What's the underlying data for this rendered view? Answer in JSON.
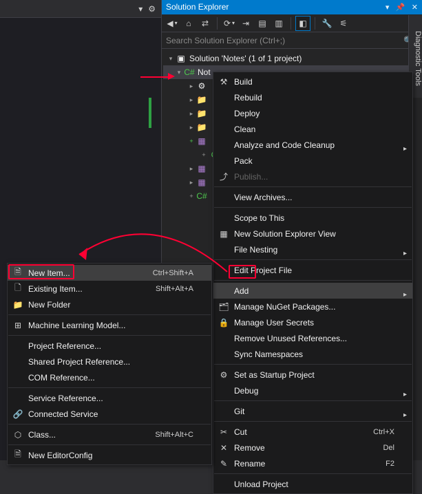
{
  "solution_explorer": {
    "title": "Solution Explorer",
    "search_placeholder": "Search Solution Explorer (Ctrl+;)",
    "solution_label": "Solution 'Notes' (1 of 1 project)",
    "project_label": "Not",
    "diagnostic_tab": "Diagnostic Tools"
  },
  "ctx_main": {
    "build": "Build",
    "rebuild": "Rebuild",
    "deploy": "Deploy",
    "clean": "Clean",
    "analyze": "Analyze and Code Cleanup",
    "pack": "Pack",
    "publish": "Publish...",
    "view_archives": "View Archives...",
    "scope": "Scope to This",
    "new_se_view": "New Solution Explorer View",
    "file_nesting": "File Nesting",
    "edit_project_file": "Edit Project File",
    "add": "Add",
    "nuget": "Manage NuGet Packages...",
    "user_secrets": "Manage User Secrets",
    "remove_refs": "Remove Unused References...",
    "sync_ns": "Sync Namespaces",
    "startup": "Set as Startup Project",
    "debug": "Debug",
    "git": "Git",
    "cut": "Cut",
    "cut_sc": "Ctrl+X",
    "remove": "Remove",
    "remove_sc": "Del",
    "rename": "Rename",
    "rename_sc": "F2",
    "unload": "Unload Project"
  },
  "ctx_add": {
    "new_item": "New Item...",
    "new_item_sc": "Ctrl+Shift+A",
    "existing_item": "Existing Item...",
    "existing_item_sc": "Shift+Alt+A",
    "new_folder": "New Folder",
    "ml_model": "Machine Learning Model...",
    "proj_ref": "Project Reference...",
    "shared_ref": "Shared Project Reference...",
    "com_ref": "COM Reference...",
    "svc_ref": "Service Reference...",
    "conn_svc": "Connected Service",
    "class": "Class...",
    "class_sc": "Shift+Alt+C",
    "editorconfig": "New EditorConfig"
  }
}
